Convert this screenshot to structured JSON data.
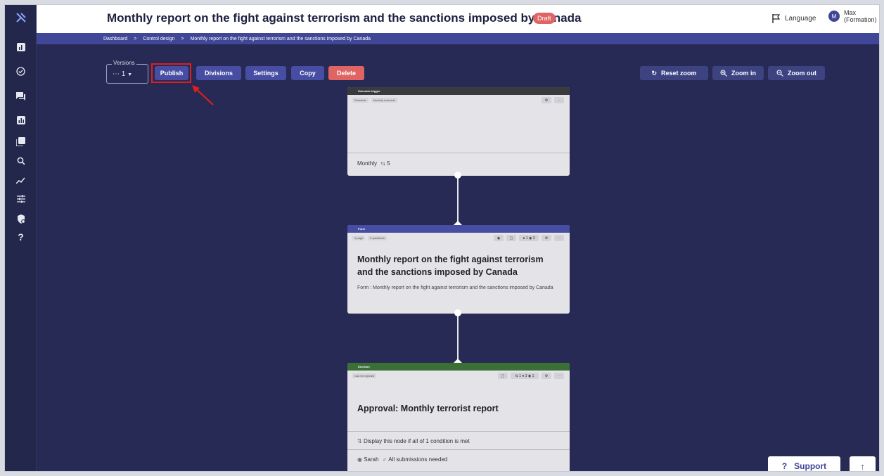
{
  "header": {
    "title": "Monthly report on the fight against terrorism and the sanctions imposed by Canada",
    "status_badge": "Draft",
    "language_label": "Language",
    "user_initial": "M",
    "user_name_line1": "Max",
    "user_name_line2": "(Formation)"
  },
  "breadcrumb": {
    "items": [
      "Dashboard",
      "Control design",
      "Monthly report on the fight against terrorism and the sanctions imposed by Canada"
    ],
    "separator": ">"
  },
  "toolbar": {
    "versions_legend": "Versions",
    "versions_value": "1",
    "publish": "Publish",
    "divisions": "Divisions",
    "settings": "Settings",
    "copy": "Copy",
    "delete": "Delete",
    "reset_zoom": "Reset zoom",
    "zoom_in": "Zoom in",
    "zoom_out": "Zoom out"
  },
  "colors": {
    "canvas": "#262a54",
    "brand": "#464da3",
    "danger": "#e06464",
    "highlight": "#e01e1e",
    "schedule_header": "#3b3b3e",
    "form_header": "#464da3",
    "decision_header": "#3a6f36"
  },
  "sidebar_icons": [
    "logo-icon",
    "chart-icon",
    "check-circle-icon",
    "chat-icon",
    "bar-chart-icon",
    "library-icon",
    "search-icon",
    "trend-icon",
    "filters-icon",
    "shield-icon",
    "help-icon"
  ],
  "nodes": {
    "schedule": {
      "header": "Schedule trigger",
      "tags": [
        "Schedule",
        "Monthly schedule"
      ],
      "footer": "Monthly",
      "footer_count": "5"
    },
    "form": {
      "header": "Form",
      "tags": [
        "1 page",
        "6 questions"
      ],
      "stats": [
        "1",
        "3"
      ],
      "title": "Monthly report on the fight against terrorism and the sanctions imposed by Canada",
      "subtitle": "Form : Monthly report on the fight against terrorism and the sanctions imposed by Canada"
    },
    "decision": {
      "header": "Decision",
      "tags": [
        "Can be rejected"
      ],
      "stats": [
        "1",
        "3",
        "1"
      ],
      "title": "Approval: Monthly terrorist report",
      "condition": "Display this node if all of 1 condition is met",
      "assignee": "Sarah",
      "submissions": "All submissions needed"
    }
  },
  "support": {
    "label": "Support",
    "icon": "?"
  }
}
